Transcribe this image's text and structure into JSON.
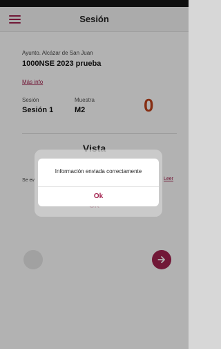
{
  "appbar": {
    "title": "Sesión"
  },
  "header": {
    "org": "Ayunto. Alcázar de San Juan",
    "project": "1000NSE 2023 prueba",
    "more_info": "Más info"
  },
  "session": {
    "session_label": "Sesión",
    "session_value": "Sesión 1",
    "sample_label": "Muestra",
    "sample_value": "M2",
    "counter": "0"
  },
  "section": {
    "title": "Vista",
    "text_left": "Se ev",
    "read_link": "Leer",
    "ok_label": "OK"
  },
  "dialog": {
    "message": "Información enviada correctamente",
    "ok_label": "Ok"
  },
  "colors": {
    "accent": "#a3234f",
    "counter": "#c0431c"
  },
  "icons": {
    "menu": "menu-icon",
    "next": "arrow-right-icon"
  }
}
